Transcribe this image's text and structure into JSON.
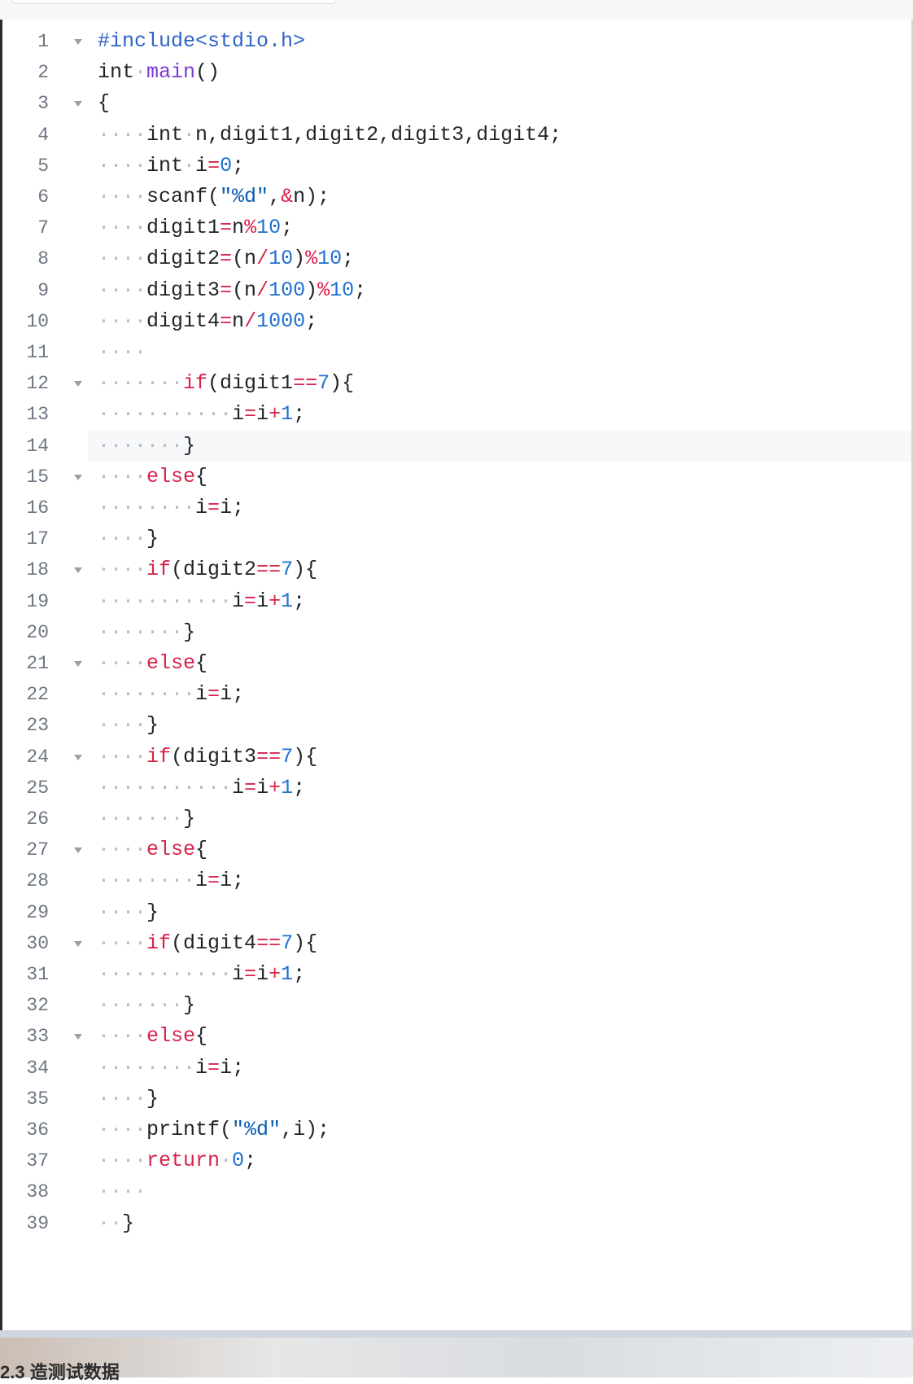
{
  "editor": {
    "lines": [
      {
        "n": "1",
        "fold": true,
        "tokens": [
          {
            "t": "#include<stdio.h>",
            "c": "inc"
          }
        ]
      },
      {
        "n": "2",
        "fold": false,
        "tokens": [
          {
            "t": "int",
            "c": "ty"
          },
          {
            "t": "·",
            "c": "ws"
          },
          {
            "t": "main",
            "c": "fn"
          },
          {
            "t": "()",
            "c": "ty"
          }
        ]
      },
      {
        "n": "3",
        "fold": true,
        "tokens": [
          {
            "t": "{",
            "c": "ty"
          }
        ]
      },
      {
        "n": "4",
        "fold": false,
        "tokens": [
          {
            "t": "····",
            "c": "ws"
          },
          {
            "t": "int",
            "c": "ty"
          },
          {
            "t": "·",
            "c": "ws"
          },
          {
            "t": "n,digit1,digit2,digit3,digit4;",
            "c": "ty"
          }
        ]
      },
      {
        "n": "5",
        "fold": false,
        "tokens": [
          {
            "t": "····",
            "c": "ws"
          },
          {
            "t": "int",
            "c": "ty"
          },
          {
            "t": "·",
            "c": "ws"
          },
          {
            "t": "i",
            "c": "ty"
          },
          {
            "t": "=",
            "c": "op"
          },
          {
            "t": "0",
            "c": "num"
          },
          {
            "t": ";",
            "c": "ty"
          }
        ]
      },
      {
        "n": "6",
        "fold": false,
        "tokens": [
          {
            "t": "····",
            "c": "ws"
          },
          {
            "t": "scanf(",
            "c": "ty"
          },
          {
            "t": "\"%d\"",
            "c": "str"
          },
          {
            "t": ",",
            "c": "ty"
          },
          {
            "t": "&",
            "c": "op"
          },
          {
            "t": "n);",
            "c": "ty"
          }
        ]
      },
      {
        "n": "7",
        "fold": false,
        "tokens": [
          {
            "t": "····",
            "c": "ws"
          },
          {
            "t": "digit1",
            "c": "ty"
          },
          {
            "t": "=",
            "c": "op"
          },
          {
            "t": "n",
            "c": "ty"
          },
          {
            "t": "%",
            "c": "op"
          },
          {
            "t": "10",
            "c": "num"
          },
          {
            "t": ";",
            "c": "ty"
          }
        ]
      },
      {
        "n": "8",
        "fold": false,
        "tokens": [
          {
            "t": "····",
            "c": "ws"
          },
          {
            "t": "digit2",
            "c": "ty"
          },
          {
            "t": "=",
            "c": "op"
          },
          {
            "t": "(n",
            "c": "ty"
          },
          {
            "t": "/",
            "c": "op"
          },
          {
            "t": "10",
            "c": "num"
          },
          {
            "t": ")",
            "c": "ty"
          },
          {
            "t": "%",
            "c": "op"
          },
          {
            "t": "10",
            "c": "num"
          },
          {
            "t": ";",
            "c": "ty"
          }
        ]
      },
      {
        "n": "9",
        "fold": false,
        "tokens": [
          {
            "t": "····",
            "c": "ws"
          },
          {
            "t": "digit3",
            "c": "ty"
          },
          {
            "t": "=",
            "c": "op"
          },
          {
            "t": "(n",
            "c": "ty"
          },
          {
            "t": "/",
            "c": "op"
          },
          {
            "t": "100",
            "c": "num"
          },
          {
            "t": ")",
            "c": "ty"
          },
          {
            "t": "%",
            "c": "op"
          },
          {
            "t": "10",
            "c": "num"
          },
          {
            "t": ";",
            "c": "ty"
          }
        ]
      },
      {
        "n": "10",
        "fold": false,
        "tokens": [
          {
            "t": "····",
            "c": "ws"
          },
          {
            "t": "digit4",
            "c": "ty"
          },
          {
            "t": "=",
            "c": "op"
          },
          {
            "t": "n",
            "c": "ty"
          },
          {
            "t": "/",
            "c": "op"
          },
          {
            "t": "1000",
            "c": "num"
          },
          {
            "t": ";",
            "c": "ty"
          }
        ]
      },
      {
        "n": "11",
        "fold": false,
        "tokens": [
          {
            "t": "····",
            "c": "ws"
          }
        ]
      },
      {
        "n": "12",
        "fold": true,
        "tokens": [
          {
            "t": "·······",
            "c": "ws"
          },
          {
            "t": "if",
            "c": "kw"
          },
          {
            "t": "(digit1",
            "c": "ty"
          },
          {
            "t": "==",
            "c": "op"
          },
          {
            "t": "7",
            "c": "num"
          },
          {
            "t": "){",
            "c": "ty"
          }
        ]
      },
      {
        "n": "13",
        "fold": false,
        "tokens": [
          {
            "t": "···········",
            "c": "ws"
          },
          {
            "t": "i",
            "c": "ty"
          },
          {
            "t": "=",
            "c": "op"
          },
          {
            "t": "i",
            "c": "ty"
          },
          {
            "t": "+",
            "c": "op"
          },
          {
            "t": "1",
            "c": "num"
          },
          {
            "t": ";",
            "c": "ty"
          }
        ]
      },
      {
        "n": "14",
        "fold": false,
        "active": true,
        "tokens": [
          {
            "t": "·······",
            "c": "ws"
          },
          {
            "t": "}",
            "c": "ty"
          }
        ]
      },
      {
        "n": "15",
        "fold": true,
        "tokens": [
          {
            "t": "····",
            "c": "ws"
          },
          {
            "t": "else",
            "c": "kw"
          },
          {
            "t": "{",
            "c": "ty"
          }
        ]
      },
      {
        "n": "16",
        "fold": false,
        "tokens": [
          {
            "t": "········",
            "c": "ws"
          },
          {
            "t": "i",
            "c": "ty"
          },
          {
            "t": "=",
            "c": "op"
          },
          {
            "t": "i;",
            "c": "ty"
          }
        ]
      },
      {
        "n": "17",
        "fold": false,
        "tokens": [
          {
            "t": "····",
            "c": "ws"
          },
          {
            "t": "}",
            "c": "ty"
          }
        ]
      },
      {
        "n": "18",
        "fold": true,
        "tokens": [
          {
            "t": "····",
            "c": "ws"
          },
          {
            "t": "if",
            "c": "kw"
          },
          {
            "t": "(digit2",
            "c": "ty"
          },
          {
            "t": "==",
            "c": "op"
          },
          {
            "t": "7",
            "c": "num"
          },
          {
            "t": "){",
            "c": "ty"
          }
        ]
      },
      {
        "n": "19",
        "fold": false,
        "tokens": [
          {
            "t": "···········",
            "c": "ws"
          },
          {
            "t": "i",
            "c": "ty"
          },
          {
            "t": "=",
            "c": "op"
          },
          {
            "t": "i",
            "c": "ty"
          },
          {
            "t": "+",
            "c": "op"
          },
          {
            "t": "1",
            "c": "num"
          },
          {
            "t": ";",
            "c": "ty"
          }
        ]
      },
      {
        "n": "20",
        "fold": false,
        "tokens": [
          {
            "t": "·······",
            "c": "ws"
          },
          {
            "t": "}",
            "c": "ty"
          }
        ]
      },
      {
        "n": "21",
        "fold": true,
        "tokens": [
          {
            "t": "····",
            "c": "ws"
          },
          {
            "t": "else",
            "c": "kw"
          },
          {
            "t": "{",
            "c": "ty"
          }
        ]
      },
      {
        "n": "22",
        "fold": false,
        "tokens": [
          {
            "t": "········",
            "c": "ws"
          },
          {
            "t": "i",
            "c": "ty"
          },
          {
            "t": "=",
            "c": "op"
          },
          {
            "t": "i;",
            "c": "ty"
          }
        ]
      },
      {
        "n": "23",
        "fold": false,
        "tokens": [
          {
            "t": "····",
            "c": "ws"
          },
          {
            "t": "}",
            "c": "ty"
          }
        ]
      },
      {
        "n": "24",
        "fold": true,
        "tokens": [
          {
            "t": "····",
            "c": "ws"
          },
          {
            "t": "if",
            "c": "kw"
          },
          {
            "t": "(digit3",
            "c": "ty"
          },
          {
            "t": "==",
            "c": "op"
          },
          {
            "t": "7",
            "c": "num"
          },
          {
            "t": "){",
            "c": "ty"
          }
        ]
      },
      {
        "n": "25",
        "fold": false,
        "tokens": [
          {
            "t": "···········",
            "c": "ws"
          },
          {
            "t": "i",
            "c": "ty"
          },
          {
            "t": "=",
            "c": "op"
          },
          {
            "t": "i",
            "c": "ty"
          },
          {
            "t": "+",
            "c": "op"
          },
          {
            "t": "1",
            "c": "num"
          },
          {
            "t": ";",
            "c": "ty"
          }
        ]
      },
      {
        "n": "26",
        "fold": false,
        "tokens": [
          {
            "t": "·······",
            "c": "ws"
          },
          {
            "t": "}",
            "c": "ty"
          }
        ]
      },
      {
        "n": "27",
        "fold": true,
        "tokens": [
          {
            "t": "····",
            "c": "ws"
          },
          {
            "t": "else",
            "c": "kw"
          },
          {
            "t": "{",
            "c": "ty"
          }
        ]
      },
      {
        "n": "28",
        "fold": false,
        "tokens": [
          {
            "t": "········",
            "c": "ws"
          },
          {
            "t": "i",
            "c": "ty"
          },
          {
            "t": "=",
            "c": "op"
          },
          {
            "t": "i;",
            "c": "ty"
          }
        ]
      },
      {
        "n": "29",
        "fold": false,
        "tokens": [
          {
            "t": "····",
            "c": "ws"
          },
          {
            "t": "}",
            "c": "ty"
          }
        ]
      },
      {
        "n": "30",
        "fold": true,
        "tokens": [
          {
            "t": "····",
            "c": "ws"
          },
          {
            "t": "if",
            "c": "kw"
          },
          {
            "t": "(digit4",
            "c": "ty"
          },
          {
            "t": "==",
            "c": "op"
          },
          {
            "t": "7",
            "c": "num"
          },
          {
            "t": "){",
            "c": "ty"
          }
        ]
      },
      {
        "n": "31",
        "fold": false,
        "tokens": [
          {
            "t": "···········",
            "c": "ws"
          },
          {
            "t": "i",
            "c": "ty"
          },
          {
            "t": "=",
            "c": "op"
          },
          {
            "t": "i",
            "c": "ty"
          },
          {
            "t": "+",
            "c": "op"
          },
          {
            "t": "1",
            "c": "num"
          },
          {
            "t": ";",
            "c": "ty"
          }
        ]
      },
      {
        "n": "32",
        "fold": false,
        "tokens": [
          {
            "t": "·······",
            "c": "ws"
          },
          {
            "t": "}",
            "c": "ty"
          }
        ]
      },
      {
        "n": "33",
        "fold": true,
        "tokens": [
          {
            "t": "····",
            "c": "ws"
          },
          {
            "t": "else",
            "c": "kw"
          },
          {
            "t": "{",
            "c": "ty"
          }
        ]
      },
      {
        "n": "34",
        "fold": false,
        "tokens": [
          {
            "t": "········",
            "c": "ws"
          },
          {
            "t": "i",
            "c": "ty"
          },
          {
            "t": "=",
            "c": "op"
          },
          {
            "t": "i;",
            "c": "ty"
          }
        ]
      },
      {
        "n": "35",
        "fold": false,
        "tokens": [
          {
            "t": "····",
            "c": "ws"
          },
          {
            "t": "}",
            "c": "ty"
          }
        ]
      },
      {
        "n": "36",
        "fold": false,
        "tokens": [
          {
            "t": "····",
            "c": "ws"
          },
          {
            "t": "printf(",
            "c": "ty"
          },
          {
            "t": "\"%d\"",
            "c": "str"
          },
          {
            "t": ",i);",
            "c": "ty"
          }
        ]
      },
      {
        "n": "37",
        "fold": false,
        "tokens": [
          {
            "t": "····",
            "c": "ws"
          },
          {
            "t": "return",
            "c": "kw"
          },
          {
            "t": "·",
            "c": "ws"
          },
          {
            "t": "0",
            "c": "num"
          },
          {
            "t": ";",
            "c": "ty"
          }
        ]
      },
      {
        "n": "38",
        "fold": false,
        "tokens": [
          {
            "t": "····",
            "c": "ws"
          }
        ]
      },
      {
        "n": "39",
        "fold": false,
        "tokens": [
          {
            "t": "··",
            "c": "ws"
          },
          {
            "t": "}",
            "c": "ty"
          }
        ]
      }
    ]
  },
  "footer": {
    "section_title": "2.3 造测试数据"
  },
  "colors": {
    "keyword": "#d6234a",
    "number": "#1f6fd1",
    "function": "#7b3ad8",
    "include": "#2d63c8",
    "line_number": "#6e7681",
    "active_line": "#f6f8fa"
  }
}
